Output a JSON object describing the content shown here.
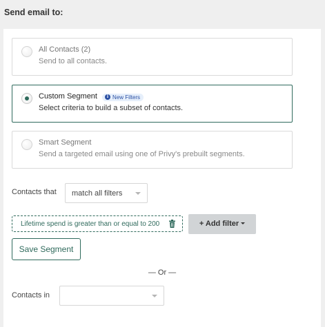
{
  "heading": "Send email to:",
  "options": [
    {
      "title": "All Contacts (2)",
      "description": "Send to all contacts.",
      "selected": false
    },
    {
      "title": "Custom Segment",
      "badge": "New Filters",
      "description": "Select criteria to build a subset of contacts.",
      "selected": true
    },
    {
      "title": "Smart Segment",
      "description": "Send a targeted email using one of Privy's prebuilt segments.",
      "selected": false
    }
  ],
  "contacts_that": {
    "label": "Contacts that",
    "value": "match all filters"
  },
  "filter": {
    "text": "Lifetime spend is greater than or equal to 200"
  },
  "add_filter_label": "+ Add filter",
  "save_segment_label": "Save Segment",
  "or_divider": "— Or —",
  "contacts_in": {
    "label": "Contacts in",
    "value": ""
  },
  "colors": {
    "accent": "#2f6a5c",
    "badge_bg": "#e6effb",
    "badge_text": "#2a4fa3",
    "button_gray": "#d1d4d6"
  }
}
